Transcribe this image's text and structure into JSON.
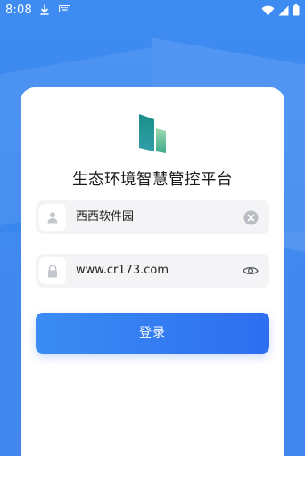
{
  "status_bar": {
    "time": "8:08",
    "left_icons": [
      "download-icon",
      "keyboard-icon"
    ],
    "right_icons": [
      "wifi-icon",
      "signal-icon",
      "battery-icon"
    ]
  },
  "app": {
    "title": "生态环境智慧管控平台",
    "logo_icon": "app-logo-icon"
  },
  "form": {
    "username": {
      "value": "西西软件园",
      "leading_icon": "user-icon",
      "trailing_icon": "clear-icon"
    },
    "password": {
      "value": "www.cr173.com",
      "leading_icon": "lock-icon",
      "trailing_icon": "eye-icon"
    },
    "login_label": "登录"
  },
  "colors": {
    "background_blue": "#3a86ef",
    "button_start": "#3a8cf3",
    "button_end": "#2e6ef0",
    "field_bg": "#f4f4f6",
    "logo_teal": "#1d8f8f",
    "logo_green": "#7fcf9a"
  }
}
